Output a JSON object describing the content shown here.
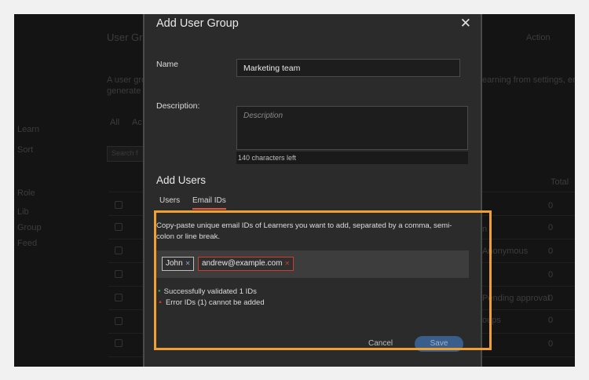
{
  "background": {
    "header_title": "User Gr",
    "header_action": "Action",
    "desc_line1": "A user gro",
    "desc_line2": "generate r",
    "desc_right": "earning from settings, enroll th",
    "tab_partial_1": "All",
    "tab_partial_2": "Ac",
    "search_partial": "Search f",
    "nav": [
      "Learn",
      "Sort",
      "Role",
      "Lib",
      "Group",
      "Feed"
    ],
    "rows": [
      "n",
      "",
      "",
      "Anonymous",
      "",
      "Pending approval",
      "oups",
      ""
    ],
    "counts": [
      "0",
      "0",
      "0",
      "0",
      "0",
      "0",
      "0",
      "0"
    ],
    "col_header": "Total"
  },
  "modal": {
    "title": "Add User Group",
    "name_label": "Name",
    "name_value": "Marketing team",
    "description_label": "Description:",
    "description_placeholder": "Description",
    "chars_left": "140 characters left",
    "add_users_title": "Add Users",
    "tabs": [
      {
        "label": "Users",
        "active": false
      },
      {
        "label": "Email IDs",
        "active": true
      }
    ],
    "instructions": "Copy-paste unique email IDs of Learners you want to add, separated by a comma, semi-colon or line break.",
    "chips": [
      {
        "label": "John",
        "status": "valid"
      },
      {
        "label": "andrew@example.com",
        "status": "invalid"
      }
    ],
    "validation": {
      "success": "Successfully validated 1 IDs",
      "error": "Error IDs (1) cannot be added"
    },
    "cancel_label": "Cancel",
    "save_label": "Save"
  },
  "colors": {
    "highlight": "#f0a030",
    "active_tab_underline": "#e0553b",
    "error": "#d23a2e",
    "success": "#2fa84f",
    "save_button": "#3a5e8c"
  }
}
